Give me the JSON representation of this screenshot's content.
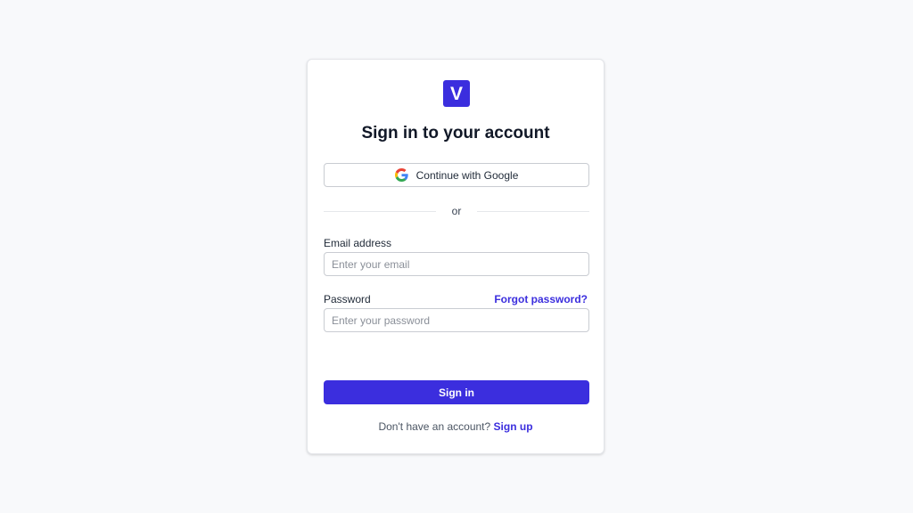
{
  "brand": {
    "logo_letter": "V",
    "accent_color": "#3b2ede"
  },
  "title": "Sign in to your account",
  "google_button": {
    "icon": "google-icon",
    "label": "Continue with Google"
  },
  "divider_text": "or",
  "email": {
    "label": "Email address",
    "placeholder": "Enter your email",
    "value": ""
  },
  "password": {
    "label": "Password",
    "forgot_link": "Forgot password?",
    "placeholder": "Enter your password",
    "value": ""
  },
  "submit_label": "Sign in",
  "footer": {
    "prompt": "Don't have an account?",
    "link": "Sign up"
  }
}
